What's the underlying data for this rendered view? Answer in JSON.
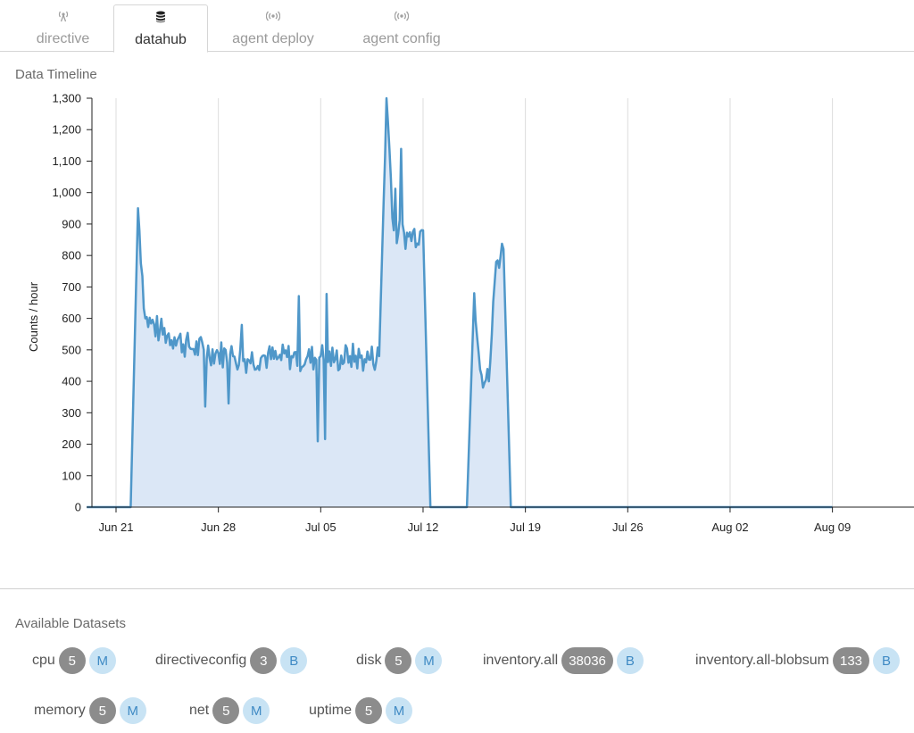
{
  "tabs": [
    {
      "label": "directive",
      "icon": "antenna-icon",
      "active": false
    },
    {
      "label": "datahub",
      "icon": "database-icon",
      "active": true
    },
    {
      "label": "agent deploy",
      "icon": "broadcast-icon",
      "active": false
    },
    {
      "label": "agent config",
      "icon": "broadcast-icon",
      "active": false
    }
  ],
  "timeline": {
    "title": "Data Timeline"
  },
  "chart_data": {
    "type": "area",
    "title": "",
    "xlabel": "",
    "ylabel": "Counts / hour",
    "ylim": [
      0,
      1300
    ],
    "yticks": [
      "0",
      "100",
      "200",
      "300",
      "400",
      "500",
      "600",
      "700",
      "800",
      "900",
      "1,000",
      "1,100",
      "1,200",
      "1,300"
    ],
    "xticks": [
      "Jun 21",
      "Jun 28",
      "Jul 05",
      "Jul 12",
      "Jul 19",
      "Jul 26",
      "Aug 02",
      "Aug 09"
    ],
    "grid": "vertical",
    "line_color": "#4f97c9",
    "fill_color": "#dbe7f6",
    "series": [
      {
        "x": [
          "Jun 19",
          "Jun 20",
          "Jun 21",
          "Jun 22",
          "Jun 22.5",
          "Jun 23",
          "Jun 24",
          "Jun 25",
          "Jun 26",
          "Jun 27",
          "Jun 28",
          "Jun 29",
          "Jun 30",
          "Jul 01",
          "Jul 02",
          "Jul 03",
          "Jul 04",
          "Jul 05",
          "Jul 06",
          "Jul 07",
          "Jul 08",
          "Jul 09",
          "Jul 09.5",
          "Jul 10",
          "Jul 11",
          "Jul 12",
          "Jul 12.5",
          "Jul 13",
          "Jul 14",
          "Jul 15",
          "Jul 15.5",
          "Jul 16",
          "Jul 16.5",
          "Jul 17",
          "Jul 17.5",
          "Jul 18",
          "Jul 19",
          "Jul 26",
          "Aug 02",
          "Aug 09",
          "Aug 15"
        ],
        "values": [
          0,
          0,
          0,
          0,
          950,
          600,
          560,
          540,
          510,
          500,
          490,
          480,
          470,
          480,
          470,
          480,
          470,
          480,
          470,
          480,
          470,
          480,
          1300,
          880,
          860,
          880,
          0,
          0,
          0,
          0,
          680,
          420,
          400,
          780,
          820,
          0,
          0,
          0,
          0,
          0,
          0
        ]
      }
    ]
  },
  "datasets": {
    "title": "Available Datasets",
    "items": [
      {
        "name": "cpu",
        "count": "5",
        "type": "M"
      },
      {
        "name": "directiveconfig",
        "count": "3",
        "type": "B"
      },
      {
        "name": "disk",
        "count": "5",
        "type": "M"
      },
      {
        "name": "inventory.all",
        "count": "38036",
        "type": "B"
      },
      {
        "name": "inventory.all-blobsum",
        "count": "133",
        "type": "B"
      },
      {
        "name": "memory",
        "count": "5",
        "type": "M"
      },
      {
        "name": "net",
        "count": "5",
        "type": "M"
      },
      {
        "name": "uptime",
        "count": "5",
        "type": "M"
      }
    ]
  }
}
